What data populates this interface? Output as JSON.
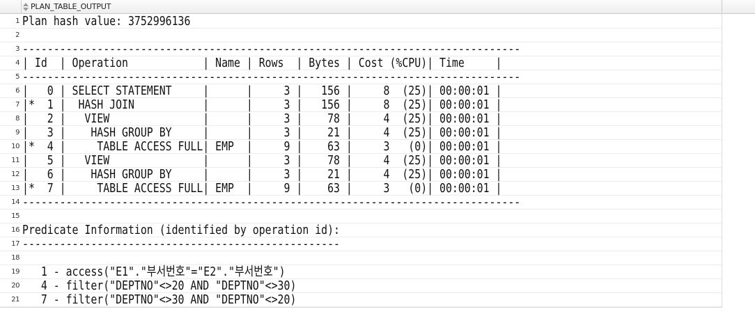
{
  "column_header": {
    "label": "PLAN_TABLE_OUTPUT",
    "icon": "sort-icon"
  },
  "rows": [
    {
      "num": "1",
      "text": "Plan hash value: 3752996136"
    },
    {
      "num": "2",
      "text": ""
    },
    {
      "num": "3",
      "text": "--------------------------------------------------------------------------------"
    },
    {
      "num": "4",
      "text": "| Id  | Operation            | Name | Rows  | Bytes | Cost (%CPU)| Time     |"
    },
    {
      "num": "5",
      "text": "--------------------------------------------------------------------------------"
    },
    {
      "num": "6",
      "text": "|   0 | SELECT STATEMENT     |      |     3 |   156 |     8  (25)| 00:00:01 |"
    },
    {
      "num": "7",
      "text": "|*  1 |  HASH JOIN           |      |     3 |   156 |     8  (25)| 00:00:01 |"
    },
    {
      "num": "8",
      "text": "|   2 |   VIEW               |      |     3 |    78 |     4  (25)| 00:00:01 |"
    },
    {
      "num": "9",
      "text": "|   3 |    HASH GROUP BY     |      |     3 |    21 |     4  (25)| 00:00:01 |"
    },
    {
      "num": "10",
      "text": "|*  4 |     TABLE ACCESS FULL| EMP  |     9 |    63 |     3   (0)| 00:00:01 |"
    },
    {
      "num": "11",
      "text": "|   5 |   VIEW               |      |     3 |    78 |     4  (25)| 00:00:01 |"
    },
    {
      "num": "12",
      "text": "|   6 |    HASH GROUP BY     |      |     3 |    21 |     4  (25)| 00:00:01 |"
    },
    {
      "num": "13",
      "text": "|*  7 |     TABLE ACCESS FULL| EMP  |     9 |    63 |     3   (0)| 00:00:01 |"
    },
    {
      "num": "14",
      "text": "--------------------------------------------------------------------------------"
    },
    {
      "num": "15",
      "text": ""
    },
    {
      "num": "16",
      "text": "Predicate Information (identified by operation id):"
    },
    {
      "num": "17",
      "text": "---------------------------------------------------"
    },
    {
      "num": "18",
      "text": ""
    },
    {
      "num": "19",
      "text": "   1 - access(\"E1\".\"부서번호\"=\"E2\".\"부서번호\")"
    },
    {
      "num": "20",
      "text": "   4 - filter(\"DEPTNO\"<>20 AND \"DEPTNO\"<>30)"
    },
    {
      "num": "21",
      "text": "   7 - filter(\"DEPTNO\"<>30 AND \"DEPTNO\"<>20)"
    }
  ]
}
